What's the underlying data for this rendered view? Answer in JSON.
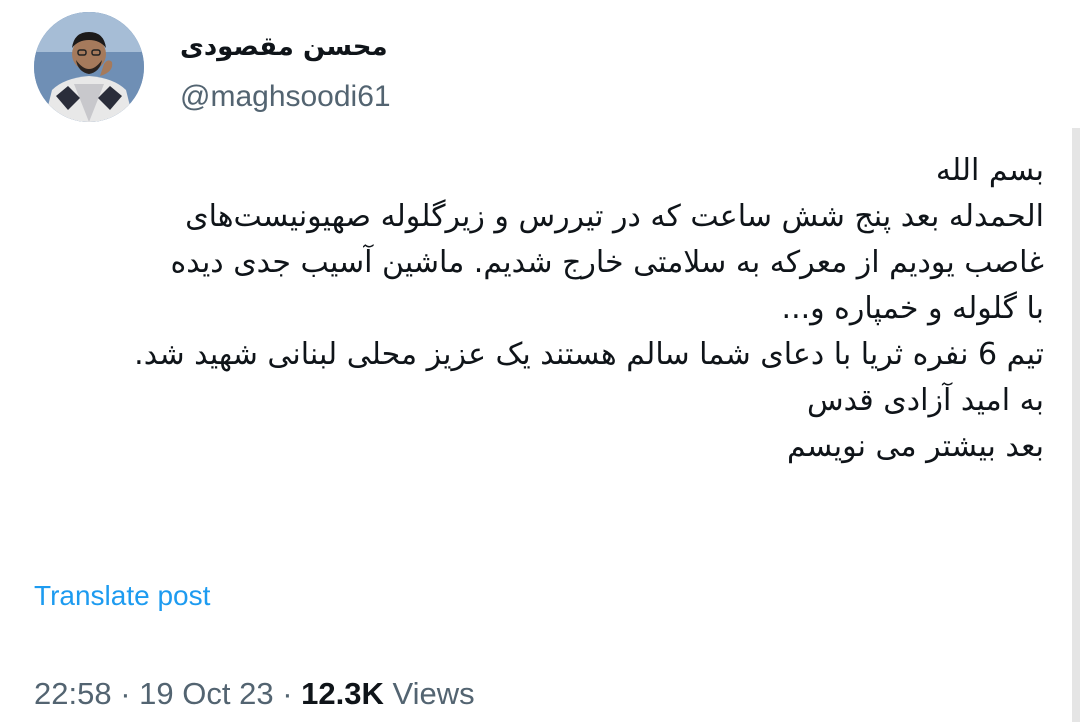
{
  "author": {
    "display_name": "محسن مقصودی",
    "handle": "@maghsoodi61"
  },
  "tweet": {
    "lines": [
      "بسم الله",
      "الحمدله بعد پنج شش ساعت که در تیررس و زیرگلوله صهیونیست‌های",
      "غاصب یودیم از معرکه به سلامتی خارج شدیم. ماشین آسیب جدی دیده",
      "با گلوله و خمپاره و...",
      "تیم 6 نفره ثریا با دعای شما سالم هستند یک عزیز محلی لبنانی شهید شد.",
      "به امید آزادی قدس",
      "بعد بیشتر می نویسم"
    ],
    "translate_label": "Translate post"
  },
  "meta": {
    "time": "22:58",
    "separator": "·",
    "date": "19 Oct 23",
    "views_count": "12.3K",
    "views_label": "Views"
  },
  "colors": {
    "text": "#0f1419",
    "secondary": "#536471",
    "link": "#1d9bf0"
  }
}
